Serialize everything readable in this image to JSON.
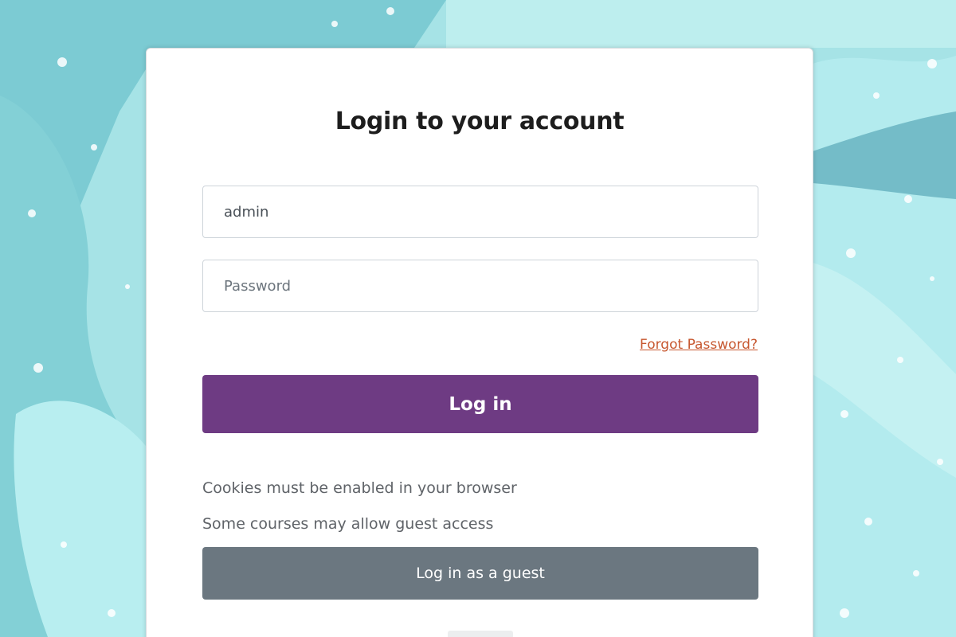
{
  "page": {
    "title": "Login to your account"
  },
  "form": {
    "username_value": "admin",
    "password_placeholder": "Password",
    "forgot_label": "Forgot Password?",
    "login_label": "Log in"
  },
  "info": {
    "cookies_text": "Cookies must be enabled in your browser",
    "guest_text": "Some courses may allow guest access"
  },
  "guest": {
    "button_label": "Log in as a guest"
  },
  "colors": {
    "background": "#9fe1e3",
    "primary_button": "#6e3b83",
    "secondary_button": "#6b7780",
    "link": "#c7572f"
  }
}
